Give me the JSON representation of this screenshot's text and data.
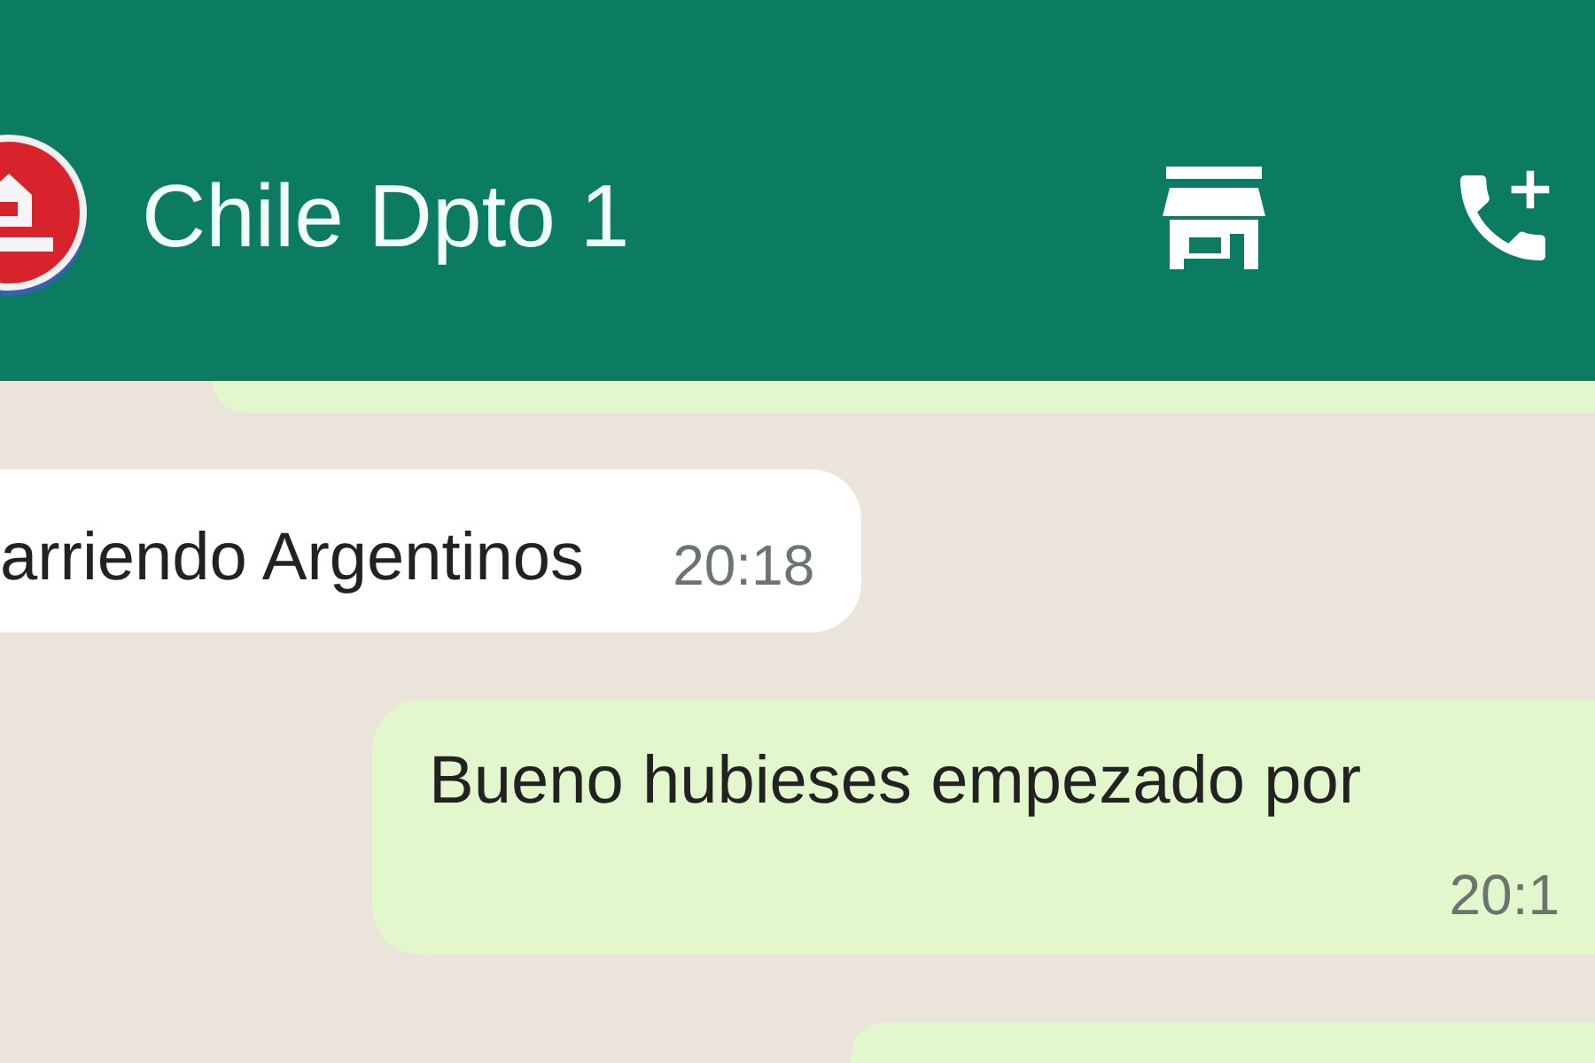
{
  "header": {
    "title": "Chile Dpto 1"
  },
  "messages": [
    {
      "kind": "outgoing"
    },
    {
      "kind": "incoming",
      "text": "arriendo Argentinos",
      "time": "20:18"
    },
    {
      "kind": "outgoing",
      "text": "Bueno hubieses empezado por",
      "time": "20:1"
    },
    {
      "kind": "outgoing"
    }
  ]
}
